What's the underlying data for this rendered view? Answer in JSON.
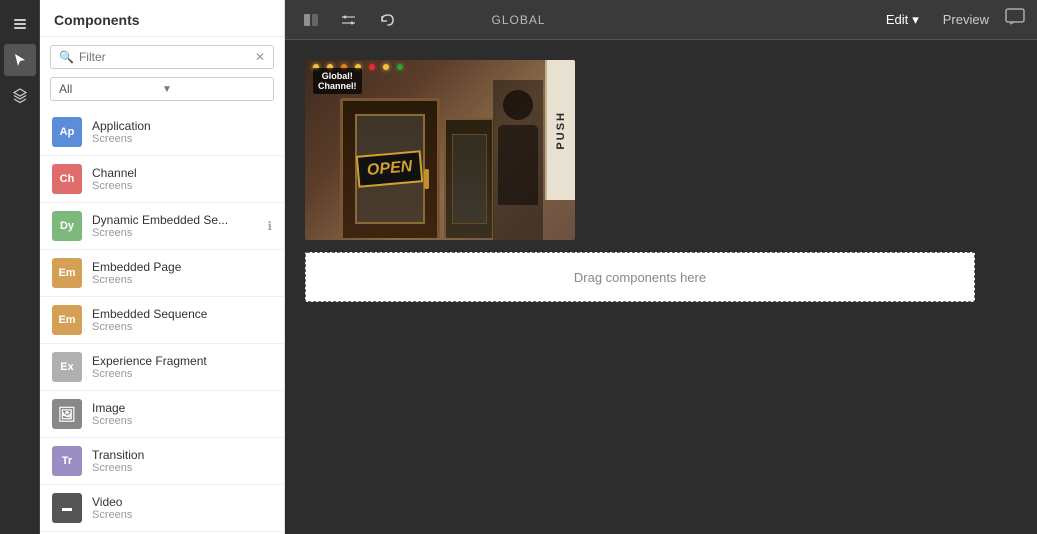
{
  "iconBar": {
    "icons": [
      {
        "name": "layers-icon",
        "symbol": "⊞",
        "active": false
      },
      {
        "name": "pointer-icon",
        "symbol": "↖",
        "active": true
      },
      {
        "name": "stacked-icon",
        "symbol": "⊟",
        "active": false
      }
    ]
  },
  "sidebar": {
    "title": "Components",
    "searchPlaceholder": "Filter",
    "filterLabel": "All",
    "components": [
      {
        "id": "application",
        "badge": "Ap",
        "badgeClass": "badge-ap",
        "name": "Application",
        "sub": "Screens"
      },
      {
        "id": "channel",
        "badge": "Ch",
        "badgeClass": "badge-ch",
        "name": "Channel",
        "sub": "Screens"
      },
      {
        "id": "dynamic-embedded",
        "badge": "Dy",
        "badgeClass": "badge-dy",
        "name": "Dynamic Embedded Se...",
        "sub": "Screens",
        "hasInfo": true
      },
      {
        "id": "embedded-page",
        "badge": "Em",
        "badgeClass": "badge-em",
        "name": "Embedded Page",
        "sub": "Screens"
      },
      {
        "id": "embedded-sequence",
        "badge": "Em",
        "badgeClass": "badge-em",
        "name": "Embedded Sequence",
        "sub": "Screens"
      },
      {
        "id": "experience-fragment",
        "badge": "Ex",
        "badgeClass": "badge-ex",
        "name": "Experience Fragment",
        "sub": "Screens"
      },
      {
        "id": "image",
        "badge": "🖼",
        "badgeClass": "badge-img",
        "name": "Image",
        "sub": "Screens"
      },
      {
        "id": "transition",
        "badge": "Tr",
        "badgeClass": "badge-tr",
        "name": "Transition",
        "sub": "Screens"
      },
      {
        "id": "video",
        "badge": "▬",
        "badgeClass": "badge-vi",
        "name": "Video",
        "sub": "Screens"
      }
    ]
  },
  "topBar": {
    "globalLabel": "GLOBAL",
    "editLabel": "Edit",
    "previewLabel": "Preview"
  },
  "canvas": {
    "globalChannelText": "Global!\nChannel!",
    "openSignText": "OPEN",
    "pushText": "PUSH",
    "dragDropText": "Drag components here"
  }
}
